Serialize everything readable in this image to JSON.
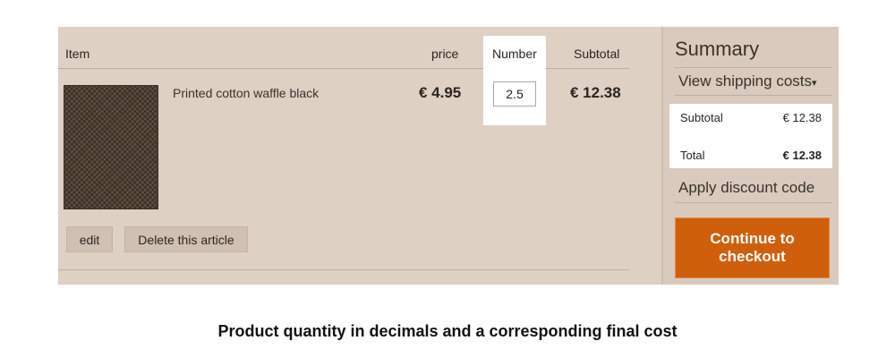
{
  "cart": {
    "headers": {
      "item": "Item",
      "price": "price",
      "number": "Number",
      "subtotal": "Subtotal"
    },
    "product": {
      "name": "Printed cotton waffle black",
      "price": "€ 4.95",
      "quantity": "2.5",
      "subtotal": "€ 12.38"
    },
    "actions": {
      "edit": "edit",
      "delete": "Delete this article"
    }
  },
  "summary": {
    "title": "Summary",
    "shipping_link": "View shipping costs",
    "subtotal_label": "Subtotal",
    "subtotal_value": "€ 12.38",
    "total_label": "Total",
    "total_value": "€ 12.38",
    "discount_link": "Apply discount code",
    "checkout_label": "Continue to checkout"
  },
  "caption": "Product quantity in decimals and a corresponding final cost",
  "colors": {
    "accent": "#d05f0c",
    "panel": "#dfd0c4"
  }
}
